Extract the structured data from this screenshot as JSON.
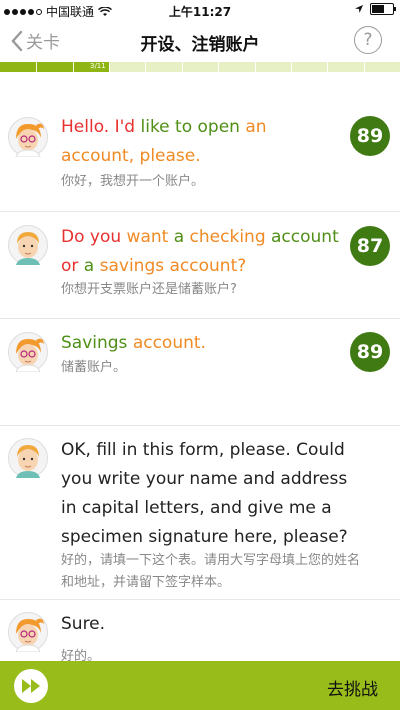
{
  "status": {
    "carrier": "中国联通",
    "time": "上午11:27"
  },
  "nav": {
    "back_label": "关卡",
    "title": "开设、注销账户",
    "help_label": "?"
  },
  "progress": {
    "text": "3/11",
    "fraction": 0.2727
  },
  "messages": [
    {
      "words": [
        {
          "t": "Hello.",
          "c": "red"
        },
        {
          "t": " I'd",
          "c": "red"
        },
        {
          "t": " like to open",
          "c": "green"
        },
        {
          "t": " an account,",
          "c": "orange"
        },
        {
          "t": " please.",
          "c": "orange"
        }
      ],
      "cn": "你好，我想开一个账户。",
      "score": "89"
    },
    {
      "words": [
        {
          "t": "Do you",
          "c": "red"
        },
        {
          "t": " want",
          "c": "orange"
        },
        {
          "t": " a",
          "c": "green"
        },
        {
          "t": " checking",
          "c": "orange"
        },
        {
          "t": " account",
          "c": "green"
        },
        {
          "t": " or",
          "c": "red"
        },
        {
          "t": " a",
          "c": "green"
        },
        {
          "t": " savings account?",
          "c": "orange"
        }
      ],
      "cn": "你想开支票账户还是储蓄账户?",
      "score": "87"
    },
    {
      "words": [
        {
          "t": "Savings",
          "c": "green"
        },
        {
          "t": " account.",
          "c": "orange"
        }
      ],
      "cn": "储蓄账户。",
      "score": "89"
    },
    {
      "words": [
        {
          "t": "OK, fill in this form, please. Could you write your name and address in capital letters, and give me a specimen signature here, please?",
          "c": "plain"
        }
      ],
      "cn": "好的，请填一下这个表。请用大写字母填上您的姓名和地址，并请留下签字样本。",
      "score": ""
    },
    {
      "words": [
        {
          "t": "Sure.",
          "c": "plain"
        }
      ],
      "cn": "好的。",
      "score": ""
    }
  ],
  "bottom": {
    "challenge_label": "去挑战"
  },
  "colors": {
    "accent": "#98bd1b",
    "score": "#3f7a12",
    "red": "#e8312e",
    "orange": "#f08a24",
    "green": "#4f8f16"
  }
}
